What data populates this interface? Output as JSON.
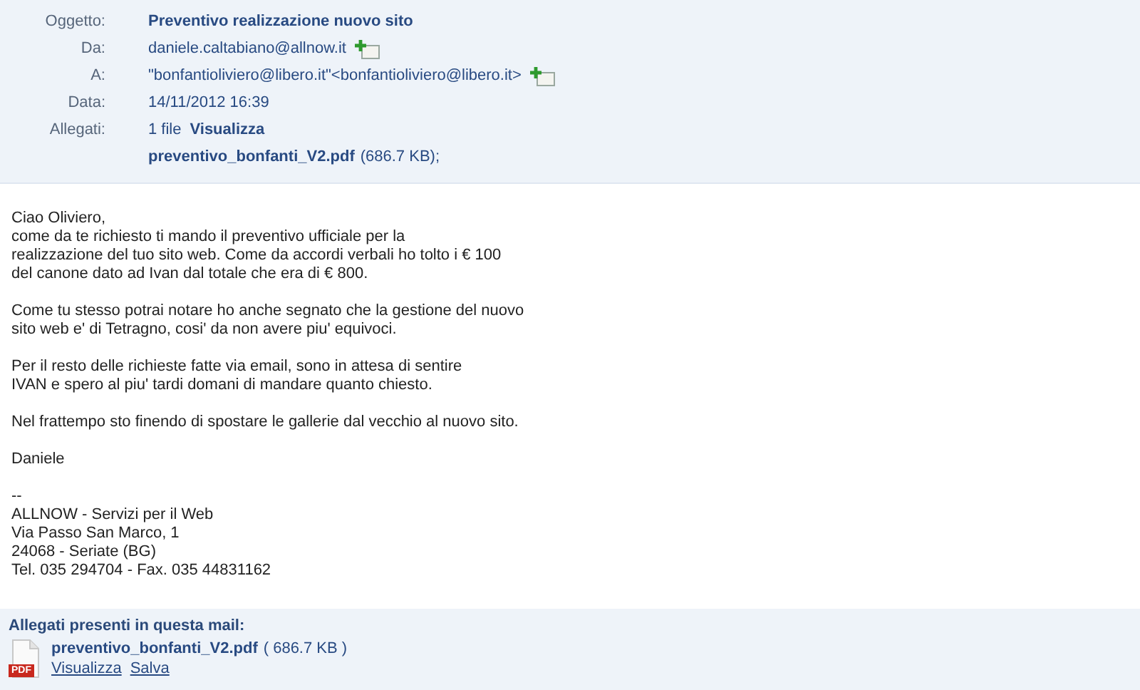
{
  "header": {
    "rows": [
      {
        "kind": "subject",
        "label": "Oggetto:",
        "value": "Preventivo realizzazione nuovo sito"
      },
      {
        "kind": "address",
        "label": "Da:",
        "value": "daniele.caltabiano@allnow.it"
      },
      {
        "kind": "address",
        "label": "A:",
        "value": "\"bonfantioliviero@libero.it\"<bonfantioliviero@libero.it>"
      },
      {
        "kind": "plain",
        "label": "Data:",
        "value": "14/11/2012 16:39"
      },
      {
        "kind": "attachments",
        "label": "Allegati:",
        "count": "1 file",
        "view_link": "Visualizza",
        "file_name": "preventivo_bonfanti_V2.pdf",
        "file_size": "(686.7 KB);"
      }
    ]
  },
  "body": {
    "paragraphs": [
      {
        "lines": [
          "Ciao Oliviero,",
          "come da te richiesto ti mando il preventivo ufficiale per la",
          "realizzazione del tuo sito web. Come da accordi verbali ho tolto i € 100",
          "del canone dato ad Ivan dal totale che era di € 800."
        ]
      },
      {
        "lines": [
          "Come tu stesso potrai notare ho anche segnato che la gestione del nuovo",
          "sito web e' di Tetragno, cosi' da non avere piu' equivoci."
        ]
      },
      {
        "lines": [
          "Per il resto delle richieste fatte via email, sono in attesa di sentire",
          "IVAN e spero al piu' tardi domani di mandare quanto chiesto."
        ]
      },
      {
        "lines": [
          "Nel frattempo sto finendo di spostare le gallerie dal vecchio al nuovo sito."
        ]
      },
      {
        "lines": [
          "Daniele"
        ]
      }
    ],
    "signature": [
      "--",
      "ALLNOW - Servizi per il Web",
      "Via Passo San Marco, 1",
      "24068 - Seriate (BG)",
      "Tel. 035 294704 - Fax. 035 44831162"
    ]
  },
  "attachments_panel": {
    "title": "Allegati presenti in questa mail:",
    "files": [
      {
        "icon_label": "PDF",
        "name": "preventivo_bonfanti_V2.pdf",
        "size": "( 686.7 KB )",
        "actions": [
          "Visualizza",
          "Salva"
        ]
      }
    ]
  }
}
